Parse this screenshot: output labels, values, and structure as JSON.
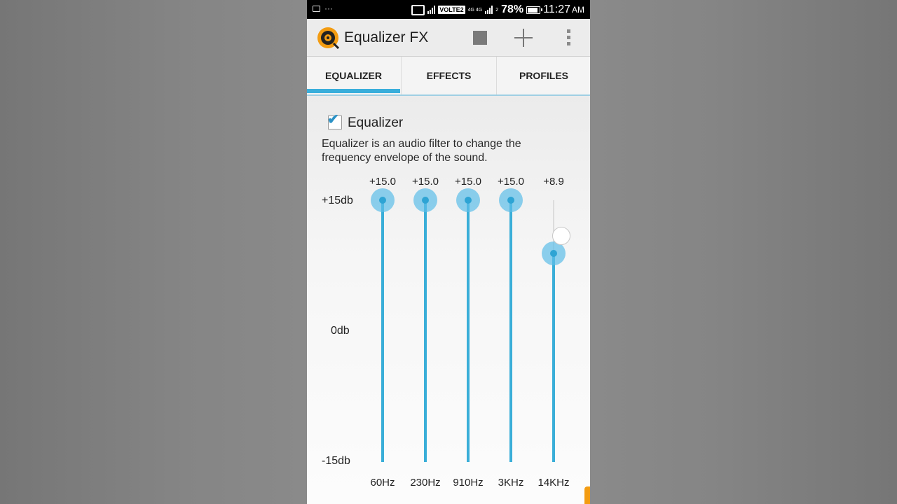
{
  "status_bar": {
    "notifications": "···",
    "network_badge": "VOLTE2",
    "network_type": "4G 4G",
    "sim_slot": "2",
    "battery": "78%",
    "time": "11:27",
    "ampm": "AM"
  },
  "app": {
    "title": "Equalizer FX",
    "icons": {
      "stop": "stop-icon",
      "add": "plus-icon",
      "menu": "more-vert-icon"
    }
  },
  "tabs": [
    {
      "label": "EQUALIZER",
      "active": true
    },
    {
      "label": "EFFECTS",
      "active": false
    },
    {
      "label": "PROFILES",
      "active": false
    }
  ],
  "equalizer": {
    "enabled": true,
    "label": "Equalizer",
    "description": "Equalizer is an audio filter to change the frequency envelope of the sound.",
    "db_max_label": "+15db",
    "db_mid_label": "0db",
    "db_min_label": "-15db",
    "range_db": [
      -15,
      15
    ],
    "bands": [
      {
        "freq": "60Hz",
        "value_label": "+15.0",
        "value": 15.0
      },
      {
        "freq": "230Hz",
        "value_label": "+15.0",
        "value": 15.0
      },
      {
        "freq": "910Hz",
        "value_label": "+15.0",
        "value": 15.0
      },
      {
        "freq": "3KHz",
        "value_label": "+15.0",
        "value": 15.0
      },
      {
        "freq": "14KHz",
        "value_label": "+8.9",
        "value": 8.9
      }
    ]
  },
  "colors": {
    "accent": "#39aedb",
    "thumb_halo": "#5cbee8",
    "side_tab": "#f39c12"
  }
}
